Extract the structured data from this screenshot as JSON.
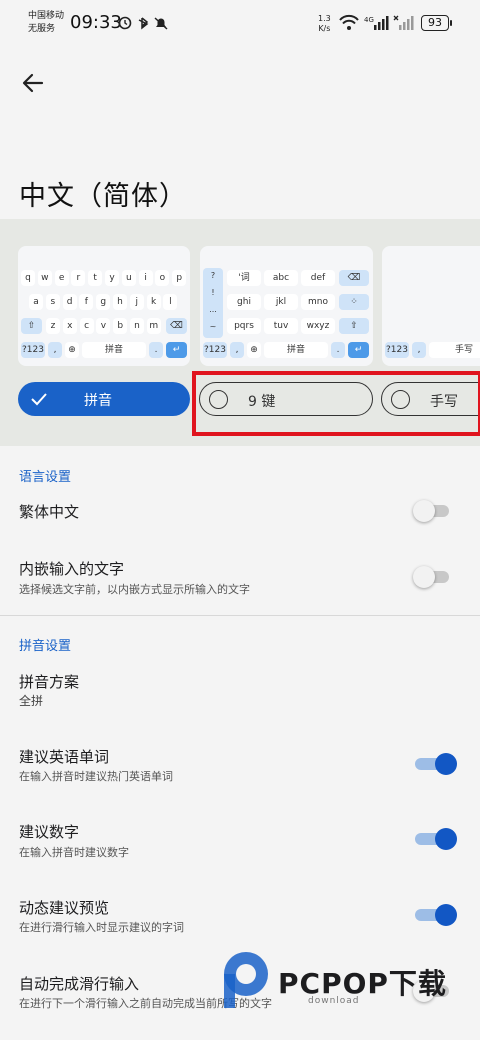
{
  "status_bar": {
    "carrier_line1": "中国移动",
    "carrier_line2": "无服务",
    "time": "09:33",
    "net_speed_value": "1.3",
    "net_speed_unit": "K/s",
    "network_type": "4G",
    "battery": "93",
    "left_icons": [
      "alarm-icon",
      "bluetooth-icon",
      "mute-bell-icon"
    ],
    "right_icons": [
      "wifi-icon",
      "signal-4g-icon",
      "no-signal-icon",
      "battery-icon"
    ]
  },
  "header": {
    "back_icon": "arrow-left-icon",
    "title": "中文（简体）"
  },
  "layouts": {
    "qwerty_rows": [
      [
        "q",
        "w",
        "e",
        "r",
        "t",
        "y",
        "u",
        "i",
        "o",
        "p"
      ],
      [
        "a",
        "s",
        "d",
        "f",
        "g",
        "h",
        "j",
        "k",
        "l"
      ],
      [
        "z",
        "x",
        "c",
        "v",
        "b",
        "n",
        "m"
      ]
    ],
    "qwerty_bottom": {
      "symbols": "?123",
      "comma": ",",
      "space": "拼音"
    },
    "ninekey_left_column": [
      "?",
      "!",
      "...",
      "~"
    ],
    "ninekey_keys": [
      "'词",
      "abc",
      "def",
      "ghi",
      "jkl",
      "mno",
      "pqrs",
      "tuv",
      "wxyz"
    ],
    "ninekey_bottom": {
      "symbols": "?123",
      "comma": ",",
      "space": "拼音"
    },
    "handwriting_bottom": {
      "symbols": "?123",
      "space": "手写"
    },
    "options": [
      {
        "label": "拼音",
        "selected": true,
        "icon": "check-icon"
      },
      {
        "label": "9 键",
        "selected": false,
        "icon": "radio-empty-icon"
      },
      {
        "label": "手写",
        "selected": false,
        "icon": "radio-empty-icon"
      }
    ]
  },
  "language_settings": {
    "header": "语言设置",
    "traditional": {
      "title": "繁体中文",
      "enabled": false
    },
    "inline_input": {
      "title": "内嵌输入的文字",
      "subtitle": "选择候选文字前，以内嵌方式显示所输入的文字",
      "enabled": false
    }
  },
  "pinyin_settings": {
    "header": "拼音设置",
    "scheme": {
      "title": "拼音方案",
      "value": "全拼"
    },
    "suggest_english": {
      "title": "建议英语单词",
      "subtitle": "在输入拼音时建议热门英语单词",
      "enabled": true
    },
    "suggest_numbers": {
      "title": "建议数字",
      "subtitle": "在输入拼音时建议数字",
      "enabled": true
    },
    "dynamic_preview": {
      "title": "动态建议预览",
      "subtitle": "在进行滑行输入时显示建议的字词",
      "enabled": true
    },
    "autocomplete_glide": {
      "title": "自动完成滑行输入",
      "subtitle": "在进行下一个滑行输入之前自动完成当前所写的文字",
      "enabled": false
    }
  },
  "watermark": {
    "brand": "PCPOP下载",
    "tagline": "download"
  },
  "colors": {
    "accent": "#1a62c8",
    "toggle_on": "#1257c4",
    "highlight_box": "#e0141e",
    "band_background": "#e6e8e4"
  }
}
